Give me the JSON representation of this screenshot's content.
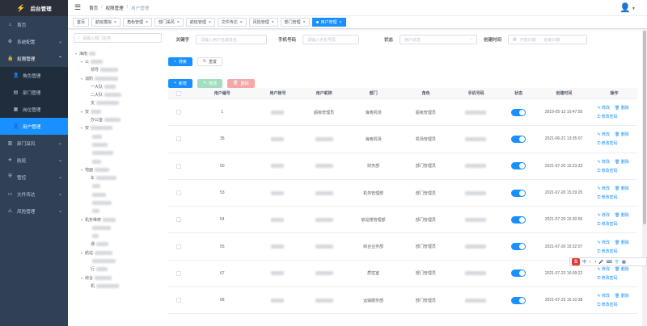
{
  "sidebar": {
    "logo_title": "后台管理",
    "items": [
      {
        "label": "首页",
        "icon": "home-icon"
      },
      {
        "label": "系统配置",
        "icon": "settings-icon"
      },
      {
        "label": "权限管理",
        "icon": "lock-icon"
      },
      {
        "label": "角色管理",
        "icon": "user-icon"
      },
      {
        "label": "部门管理",
        "icon": "tree-icon"
      },
      {
        "label": "岗位管理",
        "icon": "post-icon"
      },
      {
        "label": "用户管理",
        "icon": "user-icon"
      },
      {
        "label": "部门采风",
        "icon": "folder-icon"
      },
      {
        "label": "航班",
        "icon": "plane-icon"
      },
      {
        "label": "管控",
        "icon": "shield-icon"
      },
      {
        "label": "文件传达",
        "icon": "file-icon"
      },
      {
        "label": "风险管理",
        "icon": "alert-icon"
      }
    ]
  },
  "navbar": {
    "breadcrumb": [
      "首页",
      "权限管理",
      "用户管理"
    ]
  },
  "tags": [
    "首页",
    "航班模拟",
    "角色管理",
    "部门采风",
    "航班管理",
    "文件传达",
    "风险管理",
    "部门管理",
    "用户管理"
  ],
  "tree": {
    "search_placeholder": "请输入部门名称",
    "nodes": [
      {
        "label": "海南",
        "level": 0
      },
      {
        "label": "公",
        "level": 1
      },
      {
        "label": "领导",
        "level": 2
      },
      {
        "label": "消防",
        "level": 1
      },
      {
        "label": "一大队",
        "level": 2
      },
      {
        "label": "二大队",
        "level": 2
      },
      {
        "label": "支",
        "level": 2
      },
      {
        "label": "安",
        "level": 1
      },
      {
        "label": "办公室",
        "level": 2
      },
      {
        "label": "安",
        "level": 1
      },
      {
        "label": "",
        "level": 2
      },
      {
        "label": "",
        "level": 2
      },
      {
        "label": "",
        "level": 2
      },
      {
        "label": "",
        "level": 2
      },
      {
        "label": "地面",
        "level": 1
      },
      {
        "label": "车",
        "level": 2
      },
      {
        "label": "",
        "level": 2
      },
      {
        "label": "",
        "level": 2
      },
      {
        "label": "",
        "level": 2
      },
      {
        "label": "",
        "level": 2
      },
      {
        "label": "机务维修",
        "level": 1
      },
      {
        "label": "",
        "level": 2
      },
      {
        "label": "",
        "level": 2
      },
      {
        "label": "通",
        "level": 2
      },
      {
        "label": "航站",
        "level": 1
      },
      {
        "label": "",
        "level": 2
      },
      {
        "label": "行",
        "level": 2
      },
      {
        "label": "综合",
        "level": 1
      },
      {
        "label": "机",
        "level": 2
      }
    ]
  },
  "search_form": {
    "keyword_label": "关键字",
    "keyword_placeholder": "请输入用户名或姓名",
    "phone_label": "手机号码",
    "phone_placeholder": "请输入手机号码",
    "status_label": "状态",
    "status_placeholder": "用户状态",
    "created_label": "创建时间",
    "start_placeholder": "开始日期",
    "date_sep": "-",
    "end_placeholder": "结束日期",
    "search_button": "搜索",
    "reset_button": "重置"
  },
  "toolbar": {
    "add_button": "新增",
    "edit_button": "修改",
    "delete_button": "删除"
  },
  "table": {
    "columns": [
      "用户编号",
      "用户账号",
      "用户昵称",
      "部门",
      "角色",
      "手机号码",
      "状态",
      "创建时间",
      "操作"
    ],
    "rows": [
      {
        "id": "1",
        "nickname": "超级管理员",
        "dept": "海南机场",
        "role": "超级管理员",
        "created": "2019-05-13 10:47:55",
        "status": "on"
      },
      {
        "id": "35",
        "nickname": "",
        "dept": "海南机场",
        "role": "机场管理员",
        "created": "2021-06-21 13:35:07",
        "status": "on"
      },
      {
        "id": "50",
        "nickname": "",
        "dept": "财务部",
        "role": "部门管理员",
        "created": "2021-07-20 15:23:33",
        "status": "on"
      },
      {
        "id": "53",
        "nickname": "",
        "dept": "机务管理部",
        "role": "部门管理员",
        "created": "2021-07-20 15:29:25",
        "status": "on"
      },
      {
        "id": "54",
        "nickname": "",
        "dept": "航站楼管理部",
        "role": "部门管理员",
        "created": "2021-07-20 15:30:56",
        "status": "on"
      },
      {
        "id": "55",
        "nickname": "",
        "dept": "综合业务部",
        "role": "部门管理员",
        "created": "2021-07-20 15:32:07",
        "status": "on"
      },
      {
        "id": "67",
        "nickname": "",
        "dept": "质控室",
        "role": "部门管理员",
        "created": "2021-07-23 16:09:22",
        "status": "on"
      },
      {
        "id": "68",
        "nickname": "",
        "dept": "运输服务部",
        "role": "部门管理员",
        "created": "2021-07-23 16:10:38",
        "status": "on"
      }
    ],
    "op_edit": "修改",
    "op_delete": "删除",
    "op_reset_pwd": "修改密码"
  },
  "ime": {
    "logo": "S",
    "label": "中"
  }
}
